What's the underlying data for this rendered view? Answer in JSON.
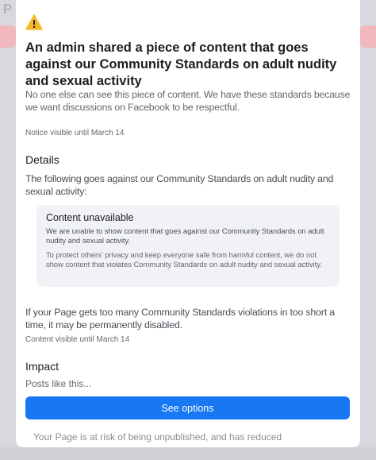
{
  "background": {
    "letter": "P"
  },
  "dialog": {
    "title": "An admin shared a piece of content that goes against our Community Standards on adult nudity and sexual activity",
    "subtitle": "No one else can see this piece of content. We have these standards because we want discussions on Facebook to be respectful.",
    "notice": "Notice visible until March 14",
    "details": {
      "heading": "Details",
      "text": "The following goes against our Community Standards on adult nudity and sexual activity:",
      "content_box": {
        "title": "Content unavailable",
        "paragraph1": "We are unable to show content that goes against our Community Standards on adult nudity and sexual activity.",
        "paragraph2": "To protect others' privacy and keep everyone safe from harmful content, we do not show content that violates Community Standards on adult nudity and sexual activity."
      }
    },
    "violations_text": "If your Page gets too many Community Standards violations in too short a time, it may be permanently disabled.",
    "content_visible": "Content visible until March 14",
    "impact": {
      "heading": "Impact",
      "text": "Posts like this..."
    },
    "primary_button": "See options",
    "footer_text": "Your Page is at risk of being unpublished, and has reduced"
  },
  "colors": {
    "primary": "#1877f2",
    "warning": "#f7b928",
    "text_primary": "#1c1e21",
    "text_secondary": "#65676b",
    "box_background": "#f0f2f5"
  },
  "icons": {
    "warning": "warning-triangle-icon"
  }
}
